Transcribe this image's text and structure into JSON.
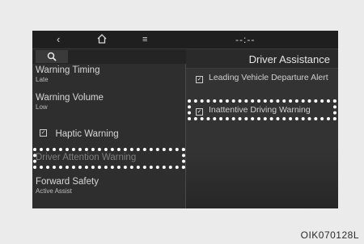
{
  "topbar": {
    "back_icon": "chevron-left-icon",
    "home_icon": "home-icon",
    "menu_icon": "menu-icon",
    "clock": "--:--"
  },
  "left_panel": {
    "search_icon": "search-icon",
    "items": [
      {
        "title": "Warning Timing",
        "value": "Late"
      },
      {
        "title": "Warning Volume",
        "value": "Low"
      },
      {
        "title": "Haptic Warning",
        "checked": true
      },
      {
        "title": "Driver Attention Warning",
        "disabled": true
      },
      {
        "title": "Forward Safety",
        "value": "Active Assist"
      }
    ]
  },
  "right_panel": {
    "title": "Driver Assistance",
    "options": [
      {
        "label": "Leading Vehicle Departure Alert",
        "checked": true
      },
      {
        "label": "Inattentive Driving Warning",
        "checked": true
      }
    ]
  },
  "caption": "OIK070128L"
}
